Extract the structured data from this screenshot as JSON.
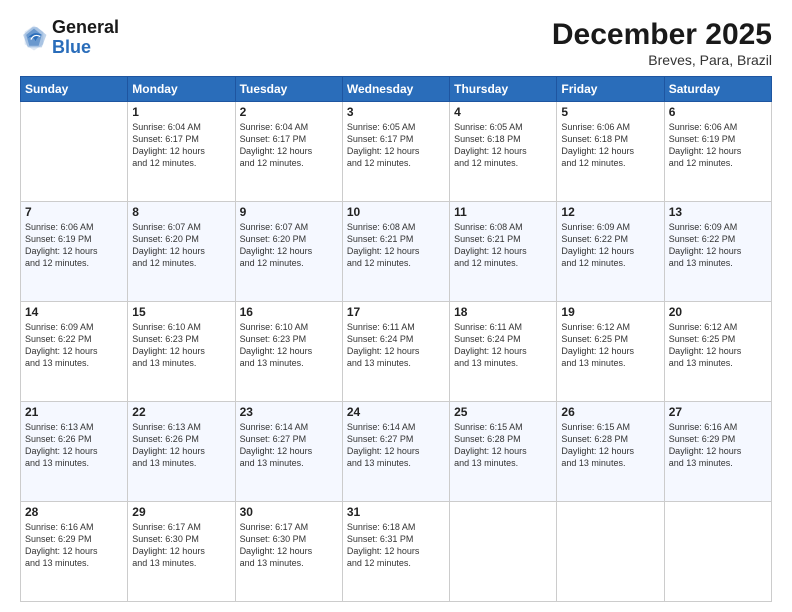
{
  "header": {
    "logo_line1": "General",
    "logo_line2": "Blue",
    "month": "December 2025",
    "location": "Breves, Para, Brazil"
  },
  "days_of_week": [
    "Sunday",
    "Monday",
    "Tuesday",
    "Wednesday",
    "Thursday",
    "Friday",
    "Saturday"
  ],
  "weeks": [
    [
      {
        "day": "",
        "info": ""
      },
      {
        "day": "1",
        "info": "Sunrise: 6:04 AM\nSunset: 6:17 PM\nDaylight: 12 hours\nand 12 minutes."
      },
      {
        "day": "2",
        "info": "Sunrise: 6:04 AM\nSunset: 6:17 PM\nDaylight: 12 hours\nand 12 minutes."
      },
      {
        "day": "3",
        "info": "Sunrise: 6:05 AM\nSunset: 6:17 PM\nDaylight: 12 hours\nand 12 minutes."
      },
      {
        "day": "4",
        "info": "Sunrise: 6:05 AM\nSunset: 6:18 PM\nDaylight: 12 hours\nand 12 minutes."
      },
      {
        "day": "5",
        "info": "Sunrise: 6:06 AM\nSunset: 6:18 PM\nDaylight: 12 hours\nand 12 minutes."
      },
      {
        "day": "6",
        "info": "Sunrise: 6:06 AM\nSunset: 6:19 PM\nDaylight: 12 hours\nand 12 minutes."
      }
    ],
    [
      {
        "day": "7",
        "info": "Sunrise: 6:06 AM\nSunset: 6:19 PM\nDaylight: 12 hours\nand 12 minutes."
      },
      {
        "day": "8",
        "info": "Sunrise: 6:07 AM\nSunset: 6:20 PM\nDaylight: 12 hours\nand 12 minutes."
      },
      {
        "day": "9",
        "info": "Sunrise: 6:07 AM\nSunset: 6:20 PM\nDaylight: 12 hours\nand 12 minutes."
      },
      {
        "day": "10",
        "info": "Sunrise: 6:08 AM\nSunset: 6:21 PM\nDaylight: 12 hours\nand 12 minutes."
      },
      {
        "day": "11",
        "info": "Sunrise: 6:08 AM\nSunset: 6:21 PM\nDaylight: 12 hours\nand 12 minutes."
      },
      {
        "day": "12",
        "info": "Sunrise: 6:09 AM\nSunset: 6:22 PM\nDaylight: 12 hours\nand 12 minutes."
      },
      {
        "day": "13",
        "info": "Sunrise: 6:09 AM\nSunset: 6:22 PM\nDaylight: 12 hours\nand 13 minutes."
      }
    ],
    [
      {
        "day": "14",
        "info": "Sunrise: 6:09 AM\nSunset: 6:22 PM\nDaylight: 12 hours\nand 13 minutes."
      },
      {
        "day": "15",
        "info": "Sunrise: 6:10 AM\nSunset: 6:23 PM\nDaylight: 12 hours\nand 13 minutes."
      },
      {
        "day": "16",
        "info": "Sunrise: 6:10 AM\nSunset: 6:23 PM\nDaylight: 12 hours\nand 13 minutes."
      },
      {
        "day": "17",
        "info": "Sunrise: 6:11 AM\nSunset: 6:24 PM\nDaylight: 12 hours\nand 13 minutes."
      },
      {
        "day": "18",
        "info": "Sunrise: 6:11 AM\nSunset: 6:24 PM\nDaylight: 12 hours\nand 13 minutes."
      },
      {
        "day": "19",
        "info": "Sunrise: 6:12 AM\nSunset: 6:25 PM\nDaylight: 12 hours\nand 13 minutes."
      },
      {
        "day": "20",
        "info": "Sunrise: 6:12 AM\nSunset: 6:25 PM\nDaylight: 12 hours\nand 13 minutes."
      }
    ],
    [
      {
        "day": "21",
        "info": "Sunrise: 6:13 AM\nSunset: 6:26 PM\nDaylight: 12 hours\nand 13 minutes."
      },
      {
        "day": "22",
        "info": "Sunrise: 6:13 AM\nSunset: 6:26 PM\nDaylight: 12 hours\nand 13 minutes."
      },
      {
        "day": "23",
        "info": "Sunrise: 6:14 AM\nSunset: 6:27 PM\nDaylight: 12 hours\nand 13 minutes."
      },
      {
        "day": "24",
        "info": "Sunrise: 6:14 AM\nSunset: 6:27 PM\nDaylight: 12 hours\nand 13 minutes."
      },
      {
        "day": "25",
        "info": "Sunrise: 6:15 AM\nSunset: 6:28 PM\nDaylight: 12 hours\nand 13 minutes."
      },
      {
        "day": "26",
        "info": "Sunrise: 6:15 AM\nSunset: 6:28 PM\nDaylight: 12 hours\nand 13 minutes."
      },
      {
        "day": "27",
        "info": "Sunrise: 6:16 AM\nSunset: 6:29 PM\nDaylight: 12 hours\nand 13 minutes."
      }
    ],
    [
      {
        "day": "28",
        "info": "Sunrise: 6:16 AM\nSunset: 6:29 PM\nDaylight: 12 hours\nand 13 minutes."
      },
      {
        "day": "29",
        "info": "Sunrise: 6:17 AM\nSunset: 6:30 PM\nDaylight: 12 hours\nand 13 minutes."
      },
      {
        "day": "30",
        "info": "Sunrise: 6:17 AM\nSunset: 6:30 PM\nDaylight: 12 hours\nand 13 minutes."
      },
      {
        "day": "31",
        "info": "Sunrise: 6:18 AM\nSunset: 6:31 PM\nDaylight: 12 hours\nand 12 minutes."
      },
      {
        "day": "",
        "info": ""
      },
      {
        "day": "",
        "info": ""
      },
      {
        "day": "",
        "info": ""
      }
    ]
  ]
}
